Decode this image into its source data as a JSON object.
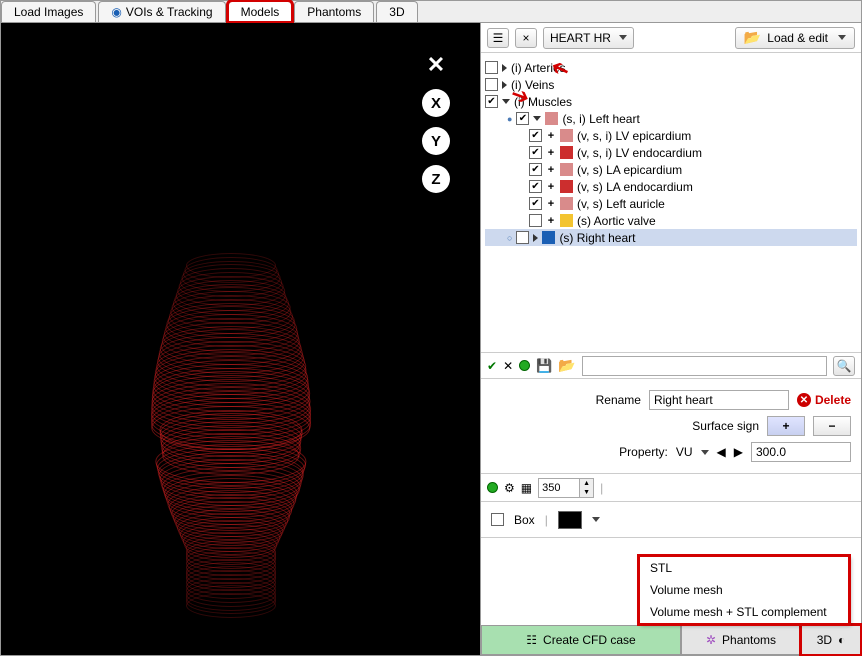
{
  "tabs": [
    "Load Images",
    "VOIs & Tracking",
    "Models",
    "Phantoms",
    "3D"
  ],
  "active_tab": "Models",
  "model_dropdown": "HEART HR",
  "load_edit": "Load & edit",
  "tree": {
    "arteries": "(i) Arteries",
    "veins": "(i) Veins",
    "muscles": "(i) Muscles",
    "left_heart": "(s, i) Left heart",
    "items": [
      {
        "label": "(v, s, i) LV epicardium",
        "color": "#d98b8b"
      },
      {
        "label": "(v, s, i) LV endocardium",
        "color": "#cc2e2e"
      },
      {
        "label": "(v, s) LA epicardium",
        "color": "#d98b8b"
      },
      {
        "label": "(v, s) LA endocardium",
        "color": "#cc2e2e"
      },
      {
        "label": "(v, s) Left auricle",
        "color": "#d98b8b"
      },
      {
        "label": "(s) Aortic valve",
        "color": "#f3c430"
      }
    ],
    "right_heart": "(s) Right heart",
    "right_heart_color": "#1a5fb4"
  },
  "rename_label": "Rename",
  "rename_value": "Right heart",
  "delete_label": "Delete",
  "surface_sign": "Surface sign",
  "property_label": "Property:",
  "property_name": "VU",
  "property_value": "300.0",
  "spinner_value": "350",
  "box_label": "Box",
  "popup": [
    "STL",
    "Volume mesh",
    "Volume mesh + STL complement"
  ],
  "actions": {
    "cfd": "Create CFD case",
    "phantoms": "Phantoms",
    "threed": "3D"
  },
  "viewer_buttons": {
    "x": "X",
    "y": "Y",
    "z": "Z"
  }
}
